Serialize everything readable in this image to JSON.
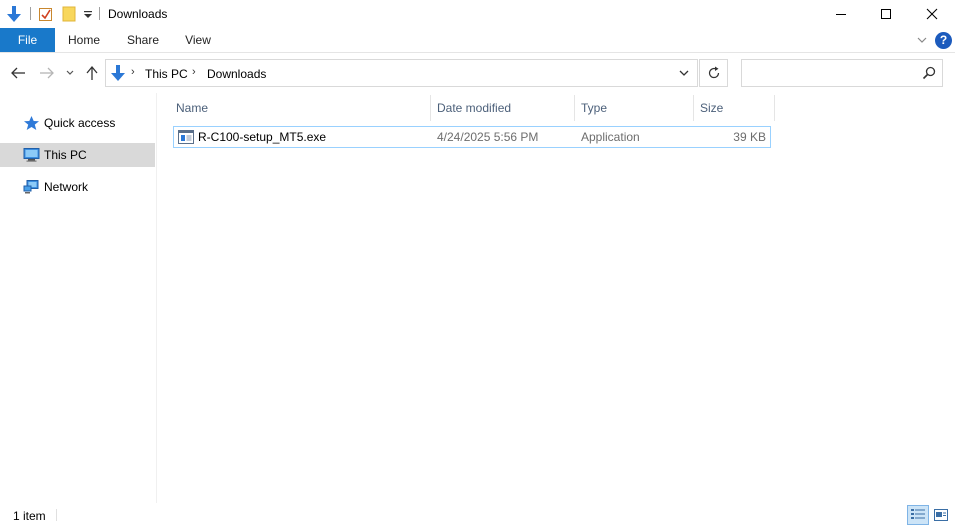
{
  "window": {
    "title": "Downloads"
  },
  "ribbon": {
    "tabs": [
      {
        "label": "File"
      },
      {
        "label": "Home"
      },
      {
        "label": "Share"
      },
      {
        "label": "View"
      }
    ],
    "help_label": "?"
  },
  "address": {
    "breadcrumbs": [
      "This PC",
      "Downloads"
    ]
  },
  "search": {
    "placeholder": ""
  },
  "sidebar": {
    "items": [
      {
        "label": "Quick access",
        "icon": "star-icon"
      },
      {
        "label": "This PC",
        "icon": "computer-icon",
        "selected": true
      },
      {
        "label": "Network",
        "icon": "network-icon"
      }
    ]
  },
  "columns": {
    "name": "Name",
    "date": "Date modified",
    "type": "Type",
    "size": "Size"
  },
  "files": [
    {
      "name": "R-C100-setup_MT5.exe",
      "date": "4/24/2025 5:56 PM",
      "type": "Application",
      "size": "39 KB",
      "icon": "application-icon"
    }
  ],
  "status": {
    "count": "1 item"
  },
  "colors": {
    "file_tab": "#1979ca",
    "selection_border": "#99d1ff",
    "sidebar_selected": "#d9d9d9",
    "header_text": "#4c607a"
  }
}
